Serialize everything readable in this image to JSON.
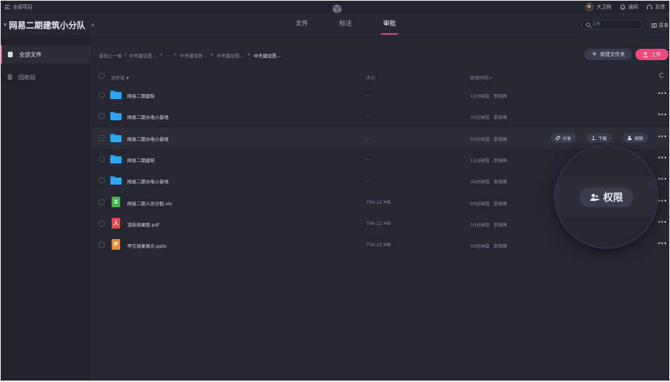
{
  "topbar": {
    "all_projects": "全部项目",
    "user_name": "大卫杨",
    "notify": "通知",
    "feedback": "反馈"
  },
  "project": {
    "title": "网易二期建筑小分队",
    "tabs": [
      "文件",
      "标注",
      "审批"
    ],
    "active_tab": "审批",
    "search_placeholder": "文件",
    "menu_label": "菜单"
  },
  "sidebar": {
    "items": [
      {
        "label": "全部文件",
        "active": true
      },
      {
        "label": "回收站",
        "active": false
      }
    ]
  },
  "breadcrumb": [
    "返回上一级",
    "|",
    "中天建设投...",
    ">",
    "...",
    ">",
    "中天建设投...",
    ">",
    "中天建设投...",
    ">",
    "中天建设投..."
  ],
  "actions": {
    "new_folder": "新建文件夹",
    "upload": "上传"
  },
  "table": {
    "headers": {
      "name": "文件名",
      "size": "大小",
      "modified": "修改时间"
    },
    "rows": [
      {
        "type": "folder",
        "name": "网易二期建筑",
        "size": "--",
        "time": "12分钟前",
        "owner": "李晓峰"
      },
      {
        "type": "folder",
        "name": "网易二期水电小基地",
        "size": "--",
        "time": "30分钟前",
        "owner": "李晓峰"
      },
      {
        "type": "folder",
        "name": "网易二期水电小基地",
        "size": "--",
        "time": "50分钟前",
        "owner": "李晓峰"
      },
      {
        "type": "folder",
        "name": "网易二期建筑",
        "size": "--",
        "time": "12分钟前",
        "owner": "李晓峰"
      },
      {
        "type": "folder",
        "name": "网易二期水电小基地",
        "size": "--",
        "time": "30分钟前",
        "owner": "李晓峰"
      },
      {
        "type": "xls",
        "glyph": "X",
        "name": "网易二期人员分配.xls",
        "size": "756.22 MB",
        "time": "50分钟前",
        "owner": "李晓峰"
      },
      {
        "type": "pdf",
        "glyph": "人",
        "name": "渲染效果图.pdf",
        "size": "756.22 MB",
        "time": "50分钟前",
        "owner": "李晓峰"
      },
      {
        "type": "ppt",
        "glyph": "P",
        "name": "甲方效果展示.pptx",
        "size": "756.22 MB",
        "time": "50分钟前",
        "owner": "李晓峰"
      }
    ],
    "row_actions": {
      "share": "分享",
      "download": "下载",
      "permission": "权限"
    },
    "more": "•••"
  },
  "magnifier": {
    "label": "权限"
  },
  "colors": {
    "accent": "#f0467e",
    "folder": "#2aa7f5",
    "bg": "#252733"
  }
}
